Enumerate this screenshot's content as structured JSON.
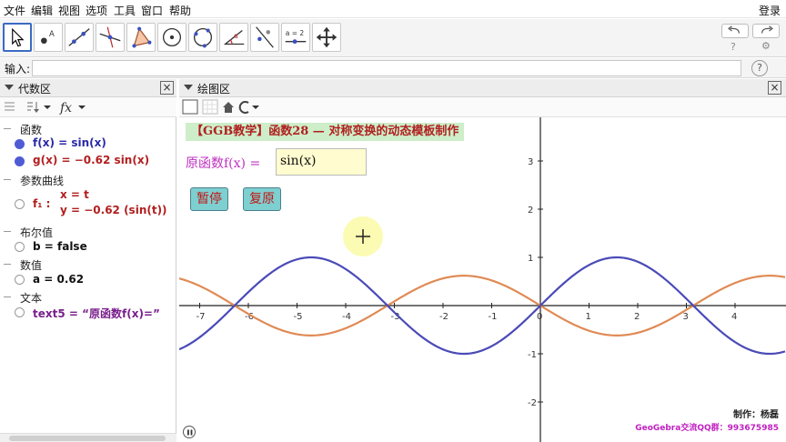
{
  "menu": {
    "items": [
      "文件",
      "编辑",
      "视图",
      "选项",
      "工具",
      "窗口",
      "帮助"
    ],
    "login": "登录"
  },
  "toolbar": {
    "tools": [
      "move-tool",
      "point-tool",
      "line-tool",
      "perpendicular-line-tool",
      "polygon-tool",
      "circle-center-point-tool",
      "circle-through-points-tool",
      "angle-tool",
      "reflect-tool",
      "slider-tool",
      "move-graphics-view-tool"
    ],
    "slider_label": "a = 2"
  },
  "inputbar": {
    "label": "输入:",
    "value": "",
    "help": "?"
  },
  "algebra": {
    "title": "代数区",
    "categories": {
      "functions": "函数",
      "param_curves": "参数曲线",
      "booleans": "布尔值",
      "numbers": "数值",
      "text": "文本"
    },
    "items": {
      "f": "f(x)  =  sin(x)",
      "g": "g(x)  =  −0.62  sin(x)",
      "f1_name": "f₁ :",
      "f1_x": "x = t",
      "f1_y": "y = −0.62  (sin(t))",
      "b": "b = false",
      "a": "a = 0.62",
      "text5": "text5  =  “原函数f(x)=”"
    },
    "colors": {
      "f": "#2a2aa8",
      "g": "#b21f1f",
      "f1": "#b21f1f",
      "text5": "#7a1f8c"
    }
  },
  "graphics": {
    "title": "绘图区",
    "banner": "【GGB教学】函数28 — 对称变换的动态模板制作",
    "orig_label": "原函数f(x) =",
    "orig_value": "sin(x)",
    "pause_label": "暂停",
    "reset_label": "复原",
    "credit": "制作：杨磊",
    "qq": "GeoGebra交流QQ群：993675985",
    "x_ticks": [
      "-7",
      "-6",
      "-5",
      "-4",
      "-3",
      "-2",
      "-1",
      "0",
      "1",
      "2",
      "3",
      "4"
    ],
    "y_ticks": [
      "3",
      "2",
      "1",
      "-1",
      "-2"
    ],
    "f_color": "#4a4ab8",
    "g_color": "#e08a55"
  }
}
